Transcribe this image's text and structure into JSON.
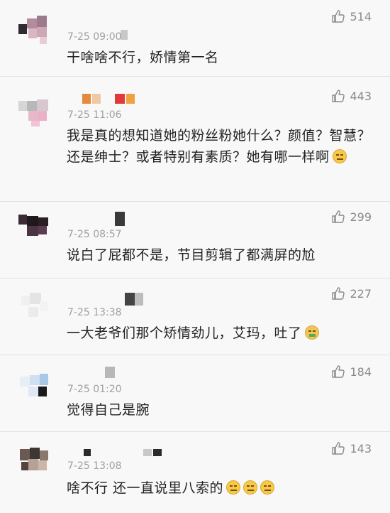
{
  "comments": [
    {
      "time": "7-25 09:00",
      "text": "干啥啥不行，娇情第一名",
      "likes": "514",
      "emojis": []
    },
    {
      "time": "7-25 11:06",
      "text": "我是真的想知道她的粉丝粉她什么？颜值？智慧？还是绅士？或者特别有素质？她有哪一样啊",
      "likes": "443",
      "emojis": [
        "thinking-emoji"
      ]
    },
    {
      "time": "7-25 08:57",
      "text": "说白了屁都不是，节目剪辑了都满屏的尬",
      "likes": "299",
      "emojis": []
    },
    {
      "time": "7-25 13:38",
      "text": "一大老爷们那个矫情劲儿，艾玛，吐了",
      "likes": "227",
      "emojis": [
        "vomit-emoji"
      ]
    },
    {
      "time": "7-25 01:20",
      "text": "觉得自己是腕",
      "likes": "184",
      "emojis": []
    },
    {
      "time": "7-25 13:08",
      "text": "啥不行 还一直说里八索的",
      "likes": "143",
      "emojis": [
        "speechless-emoji",
        "speechless-emoji",
        "speechless-emoji"
      ]
    }
  ],
  "colors": {
    "background": "#f8f8f8",
    "text": "#222222",
    "meta": "#a0a0a0",
    "like": "#8a8a8a"
  }
}
